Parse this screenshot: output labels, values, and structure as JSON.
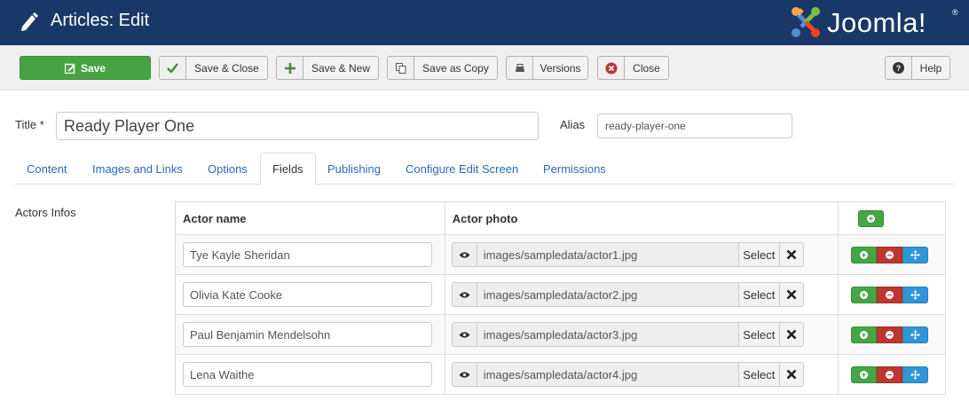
{
  "header": {
    "title": "Articles: Edit",
    "logo_text": "Joomla!",
    "logo_mark": "®"
  },
  "toolbar": {
    "save": "Save",
    "save_close": "Save & Close",
    "save_new": "Save & New",
    "save_copy": "Save as Copy",
    "versions": "Versions",
    "close": "Close",
    "help": "Help"
  },
  "form": {
    "title_label": "Title *",
    "title_value": "Ready Player One",
    "alias_label": "Alias",
    "alias_value": "ready-player-one"
  },
  "tabs": [
    {
      "label": "Content"
    },
    {
      "label": "Images and Links"
    },
    {
      "label": "Options"
    },
    {
      "label": "Fields"
    },
    {
      "label": "Publishing"
    },
    {
      "label": "Configure Edit Screen"
    },
    {
      "label": "Permissions"
    }
  ],
  "active_tab": "Fields",
  "subform": {
    "label": "Actors Infos",
    "col_name": "Actor name",
    "col_photo": "Actor photo",
    "select_label": "Select",
    "rows": [
      {
        "name": "Tye Kayle Sheridan",
        "photo": "images/sampledata/actor1.jpg"
      },
      {
        "name": "Olivia Kate Cooke",
        "photo": "images/sampledata/actor2.jpg"
      },
      {
        "name": "Paul Benjamin Mendelsohn",
        "photo": "images/sampledata/actor3.jpg"
      },
      {
        "name": "Lena Waithe",
        "photo": "images/sampledata/actor4.jpg"
      }
    ]
  },
  "colors": {
    "header_bg": "#1a3867",
    "save_green": "#45a344",
    "link_blue": "#2a69b8",
    "add_green": "#46a546",
    "remove_red": "#bd362f",
    "move_blue": "#2f96d8"
  }
}
